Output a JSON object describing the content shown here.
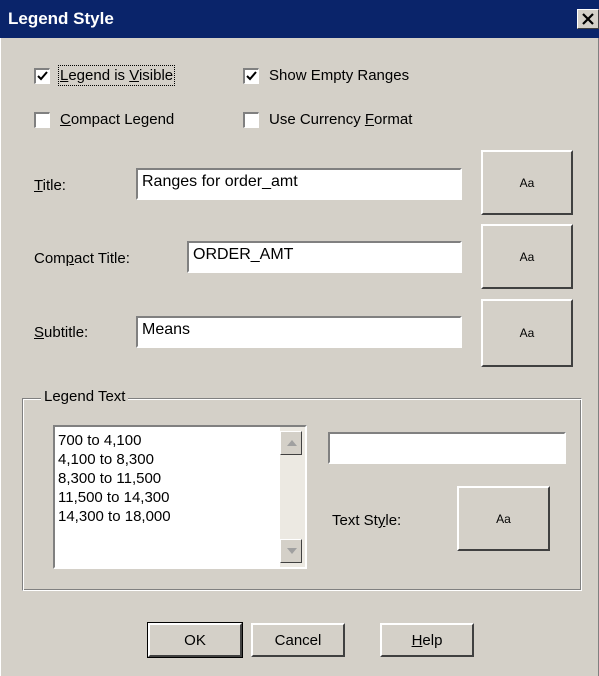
{
  "window": {
    "title": "Legend Style",
    "close_icon": "close-x-icon"
  },
  "checkboxes": {
    "legend_visible": {
      "label_pre": "",
      "label_u": "L",
      "label_mid": "egend is ",
      "label_u2": "V",
      "label_post": "isible",
      "checked": true
    },
    "show_empty": {
      "label": "Show Empty Ranges",
      "checked": true
    },
    "compact_legend": {
      "label_u": "C",
      "label_post": "ompact Legend",
      "checked": false
    },
    "currency_format": {
      "label_pre": "Use Currency ",
      "label_u": "F",
      "label_post": "ormat",
      "checked": false
    }
  },
  "fields": {
    "title": {
      "label_u": "T",
      "label_post": "itle:",
      "value": "Ranges for order_amt",
      "font_button": "Aa"
    },
    "compact_title": {
      "label_pre": "Com",
      "label_u": "p",
      "label_post": "act Title:",
      "value": "ORDER_AMT",
      "font_button": "Aa"
    },
    "subtitle": {
      "label_u": "S",
      "label_post": "ubtitle:",
      "value": "Means",
      "font_button": "Aa"
    }
  },
  "legend_text": {
    "group_label": "Legend Text",
    "items": [
      "700 to 4,100",
      "4,100 to 8,300",
      "8,300 to 11,500",
      "11,500 to 14,300",
      "14,300 to 18,000"
    ],
    "edit_value": "",
    "text_style_label_pre": "Text St",
    "text_style_label_u": "y",
    "text_style_label_post": "le:",
    "text_style_button": "Aa"
  },
  "buttons": {
    "ok": "OK",
    "cancel": "Cancel",
    "help_u": "H",
    "help_post": "elp"
  }
}
